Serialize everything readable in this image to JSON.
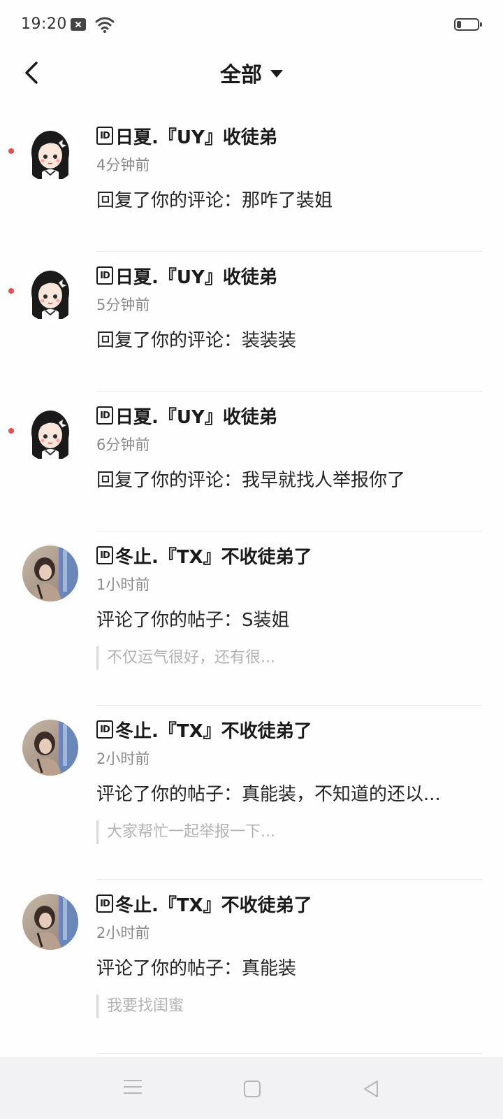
{
  "status_bar": {
    "time": "19:20",
    "icons": [
      "notification-icon",
      "wifi-icon",
      "battery-icon"
    ]
  },
  "header": {
    "back_icon": "chevron-left-icon",
    "filter_label": "全部",
    "dropdown_icon": "caret-down-icon"
  },
  "notifications": [
    {
      "badge": "ID",
      "user": "日夏.『UY』收徒弟",
      "time": "4分钟前",
      "text": "回复了你的评论：那咋了装姐",
      "unread": true,
      "avatar": "girl-cartoon"
    },
    {
      "badge": "ID",
      "user": "日夏.『UY』收徒弟",
      "time": "5分钟前",
      "text": "回复了你的评论：装装装",
      "unread": true,
      "avatar": "girl-cartoon"
    },
    {
      "badge": "ID",
      "user": "日夏.『UY』收徒弟",
      "time": "6分钟前",
      "text": "回复了你的评论：我早就找人举报你了",
      "unread": true,
      "avatar": "girl-cartoon"
    },
    {
      "badge": "ID",
      "user": "冬止.『TX』不收徒弟了",
      "time": "1小时前",
      "text": "评论了你的帖子：S装姐",
      "quote": "不仅运气很好，还有很...",
      "unread": false,
      "avatar": "photo"
    },
    {
      "badge": "ID",
      "user": "冬止.『TX』不收徒弟了",
      "time": "2小时前",
      "text": "评论了你的帖子：真能装，不知道的还以...",
      "quote": "大家帮忙一起举报一下...",
      "unread": false,
      "avatar": "photo"
    },
    {
      "badge": "ID",
      "user": "冬止.『TX』不收徒弟了",
      "time": "2小时前",
      "text": "评论了你的帖子：真能装",
      "quote": "我要找闺蜜",
      "unread": false,
      "avatar": "photo"
    }
  ],
  "nav_bar": {
    "icons": [
      "menu-icon",
      "home-square-icon",
      "back-triangle-icon"
    ]
  },
  "colors": {
    "unread_dot": "#e84e4e",
    "text_primary": "#1a1a1a",
    "text_secondary": "#8a8a8a",
    "quote_text": "#b3b3b3"
  }
}
